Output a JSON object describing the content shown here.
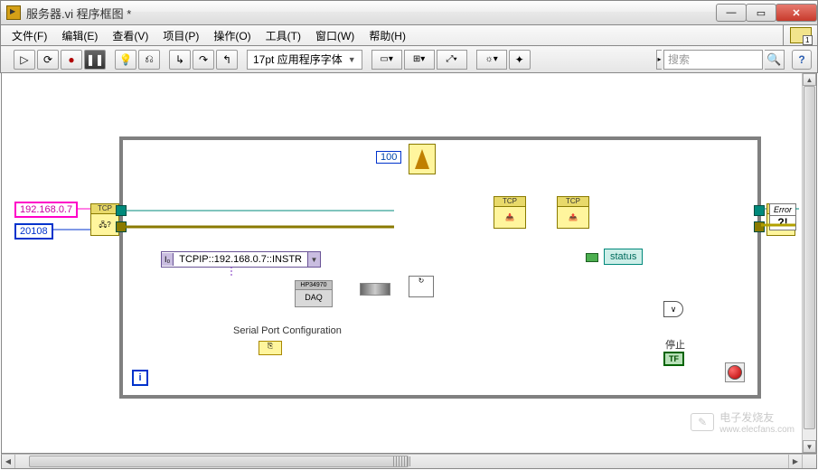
{
  "window": {
    "title": "服务器.vi 程序框图 *"
  },
  "menus": {
    "file": "文件(F)",
    "edit": "编辑(E)",
    "view": "查看(V)",
    "project": "项目(P)",
    "operate": "操作(O)",
    "tools": "工具(T)",
    "window": "窗口(W)",
    "help": "帮助(H)"
  },
  "toolbar": {
    "font_combo": "17pt 应用程序字体",
    "search_placeholder": "搜索"
  },
  "diagram": {
    "ip_const": "192.168.0.7",
    "port_const": "20108",
    "wait_ms": "100",
    "visa_resource": "TCPIP::192.168.0.7::INSTR",
    "visa_prefix": "I₀",
    "serial_label": "Serial Port Configuration",
    "daq_label_top": "HP34970",
    "daq_label": "DAQ",
    "status_label": "status",
    "stop_label": "停止",
    "stop_ind": "TF",
    "tcp_label": "TCP",
    "iter_label": "i",
    "error_label": "Error",
    "or_label": "∨"
  },
  "watermark": {
    "text": "电子发烧友",
    "url": "www.elecfans.com"
  },
  "right_badge": "1"
}
